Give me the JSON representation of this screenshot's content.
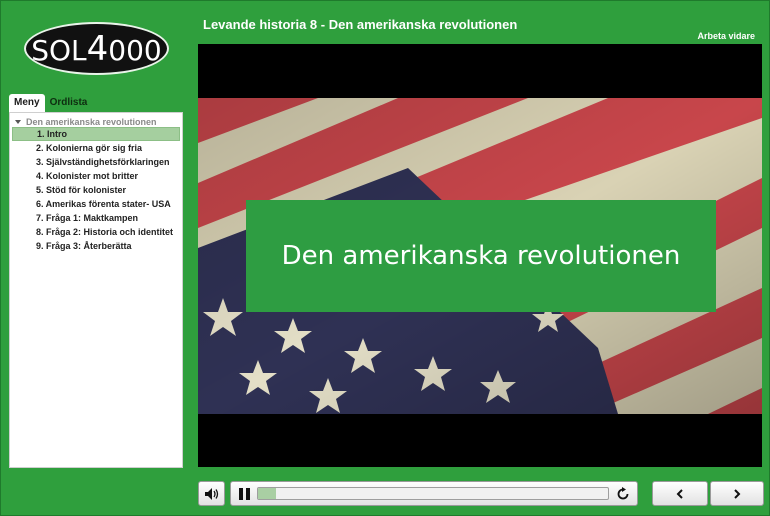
{
  "logo": {
    "part1": "SOL",
    "part2": "4",
    "part3": "000"
  },
  "header": {
    "title": "Levande historia 8 - Den amerikanska revolutionen",
    "continue_label": "Arbeta vidare"
  },
  "tabs": [
    {
      "label": "Meny",
      "active": true
    },
    {
      "label": "Ordlista",
      "active": false
    }
  ],
  "menu": {
    "root": "Den amerikanska revolutionen",
    "items": [
      "1. Intro",
      "2. Kolonierna gör sig fria",
      "3. Självständighetsförklaringen",
      "4. Kolonister mot britter",
      "5. Stöd för kolonister",
      "6. Amerikas förenta stater- USA",
      "7. Fråga 1: Maktkampen",
      "8. Fråga 2: Historia och identitet",
      "9. Fråga 3: Återberätta"
    ],
    "selected_index": 0
  },
  "video": {
    "overlay_title": "Den amerikanska revolutionen",
    "progress": 0.05
  },
  "icons": {
    "volume": "speaker-icon",
    "pause": "pause-icon",
    "replay": "replay-icon",
    "prev": "chevron-left-icon",
    "next": "chevron-right-icon"
  },
  "colors": {
    "brand_green": "#2f9f3d",
    "overlay_green": "#2e9d42",
    "selected_row": "#a5cf9f"
  }
}
